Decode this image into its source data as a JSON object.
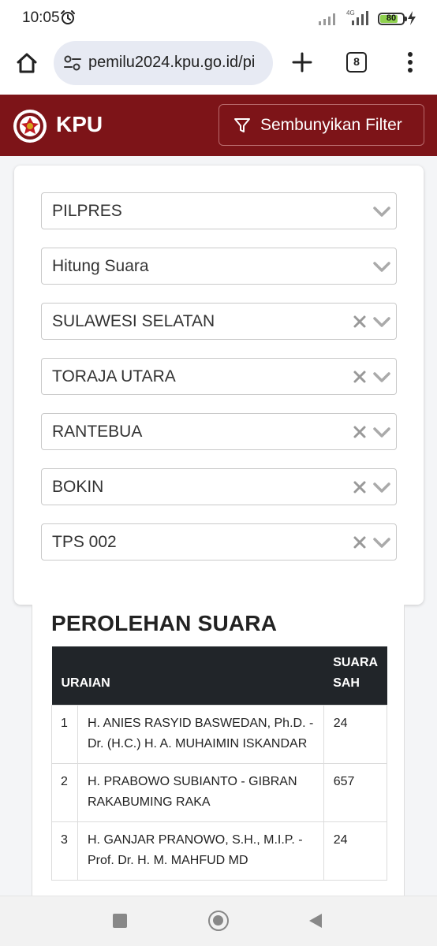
{
  "status_bar": {
    "time": "10:05",
    "network": "4G",
    "battery": "80",
    "battery_level": 0.8,
    "alarm_icon": "alarm-clock-icon",
    "charging_icon": "lightning-bolt-icon"
  },
  "browser": {
    "url": "pemilu2024.kpu.go.id/pi",
    "tab_count": "8",
    "icons": [
      "home-icon",
      "site-settings-icon",
      "plus-icon",
      "tabs-icon",
      "more-vertical-icon"
    ]
  },
  "header": {
    "brand": "KPU",
    "filter_button": "Sembunyikan Filter",
    "colors": {
      "header_bg": "#7d1418",
      "text": "#ffffff"
    }
  },
  "filters": [
    {
      "value": "PILPRES",
      "clearable": false
    },
    {
      "value": "Hitung Suara",
      "clearable": false
    },
    {
      "value": "SULAWESI SELATAN",
      "clearable": true
    },
    {
      "value": "TORAJA UTARA",
      "clearable": true
    },
    {
      "value": "RANTEBUA",
      "clearable": true
    },
    {
      "value": "BOKIN",
      "clearable": true
    },
    {
      "value": "TPS 002",
      "clearable": true
    }
  ],
  "results": {
    "title": "PEROLEHAN SUARA",
    "headers": {
      "description": "URAIAN",
      "votes": "SUARA SAH"
    },
    "rows": [
      {
        "no": "1",
        "candidate": "H. ANIES RASYID BASWEDAN, Ph.D. - Dr. (H.C.) H. A. MUHAIMIN ISKANDAR",
        "votes": "24"
      },
      {
        "no": "2",
        "candidate": "H. PRABOWO SUBIANTO - GIBRAN RAKABUMING RAKA",
        "votes": "657"
      },
      {
        "no": "3",
        "candidate": "H. GANJAR PRANOWO, S.H., M.I.P. - Prof. Dr. H. M. MAHFUD MD",
        "votes": "24"
      }
    ]
  },
  "navigation": {
    "icons": [
      "recents-icon",
      "home-circle-icon",
      "back-icon"
    ]
  }
}
